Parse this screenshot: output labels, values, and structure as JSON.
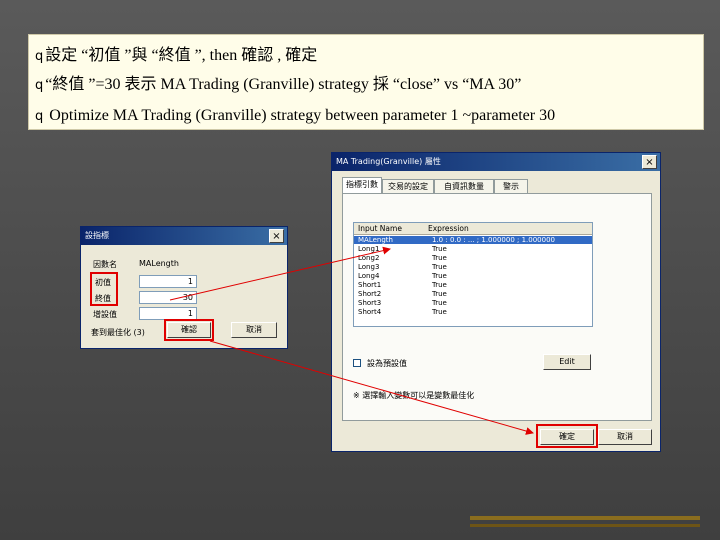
{
  "notes": {
    "line1": "設定 “初值 ”與 “終值 ”, then 確認 , 確定",
    "line2": "“終值 ”=30 表示 MA Trading (Granville) strategy 採 “close” vs “MA 30”",
    "line3": "Optimize MA Trading (Granville) strategy between parameter 1 ~parameter 30",
    "bullet": "q"
  },
  "small_dialog": {
    "title": "設指標",
    "param_name_label": "因數名",
    "param_name_value": "MALength",
    "start_label": "初值",
    "start_value": "1",
    "end_label": "終值",
    "end_value": "30",
    "step_label": "增設值",
    "step_value": "1",
    "count_label": "套到最佳化 (3)",
    "confirm_label": "確認",
    "cancel_label": "取消",
    "close_glyph": "×"
  },
  "big_dialog": {
    "title": "MA Trading(Granville) 屬性",
    "close_glyph": "×",
    "tabs": [
      "指標引數",
      "交易的設定",
      "自資訊數量",
      "警示"
    ],
    "col_input": "Input Name",
    "col_expr": "Expression",
    "rows": [
      {
        "name": "MALength",
        "expr": "1.0 : 0.0 : ... ; 1.000000 ; 1.000000"
      },
      {
        "name": "Long1",
        "expr": "True"
      },
      {
        "name": "Long2",
        "expr": "True"
      },
      {
        "name": "Long3",
        "expr": "True"
      },
      {
        "name": "Long4",
        "expr": "True"
      },
      {
        "name": "Short1",
        "expr": "True"
      },
      {
        "name": "Short2",
        "expr": "True"
      },
      {
        "name": "Short3",
        "expr": "True"
      },
      {
        "name": "Short4",
        "expr": "True"
      }
    ],
    "checkbox_label": "設為預設值",
    "edit_label": "Edit",
    "note": "※ 選擇輸入變數可以是變數最佳化",
    "ok_label": "確定",
    "cancel_label": "取消"
  }
}
